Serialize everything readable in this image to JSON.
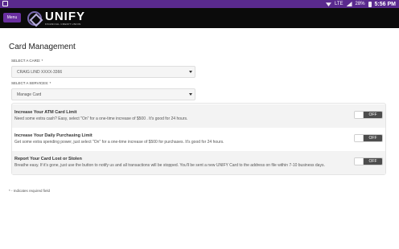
{
  "status_bar": {
    "battery": "28%",
    "time": "5:56 PM",
    "network": "LTE"
  },
  "header": {
    "menu_label": "Menu",
    "logo_word": "UNIFY",
    "logo_sub": "FINANCIAL CREDIT UNION"
  },
  "page": {
    "title": "Card Management"
  },
  "form": {
    "card_label": "SELECT A CARD: *",
    "card_value": "CRAIG LIND XXXX-3366",
    "service_label": "SELECT A SERVICES: *",
    "service_value": "Manage Card"
  },
  "services": [
    {
      "title": "Increase Your ATM Card Limit",
      "description": "Need some extra cash? Easy, select \"On\" for a one-time increase of $500 . It's good for 24 hours.",
      "toggle": "OFF"
    },
    {
      "title": "Increase Your Daily Purchasing Limit",
      "description": "Get some extra spending power, just select \"On\" for a one-time increase of $500 for purchases. It's good for 24 hours.",
      "toggle": "OFF"
    },
    {
      "title": "Report Your Card Lost or Stolen",
      "description": "Breathe easy. If it's gone, just use the button to notify us and all transactions will be stopped. You'll be sent a new UNIFY Card to the address on file within 7-10 business days.",
      "toggle": "OFF"
    }
  ],
  "footnote": "* - Indicates required field",
  "colors": {
    "status_bar": "#5a2a8e",
    "header": "#0b0b0b",
    "menu_button": "#6a2fa0",
    "toggle_off": "#4d4d4d"
  }
}
